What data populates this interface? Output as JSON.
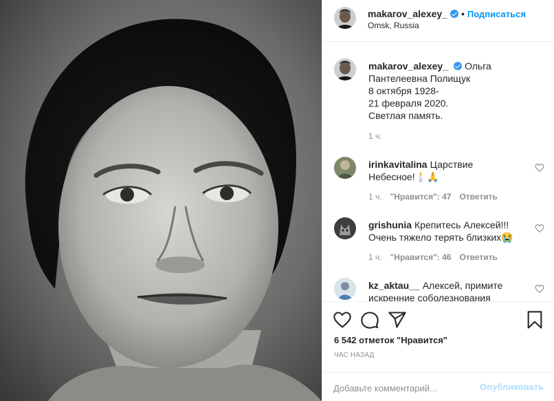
{
  "post": {
    "username": "makarov_alexey_",
    "location": "Omsk, Russia",
    "follow_label": "Подписаться",
    "separator": "•",
    "caption_lines": [
      "Ольга",
      "Пантелеевна Полищук",
      "8 октября 1928-",
      "21 февраля 2020.",
      "Светлая память."
    ],
    "caption_time": "1 ч.",
    "likes_text": "6 542 отметок \"Нравится\"",
    "posted_ago": "час назад",
    "comment_placeholder": "Добавьте комментарий...",
    "publish_label": "Опубликовать"
  },
  "comments": [
    {
      "username": "irinkavitalina",
      "text_line1": "Царствие",
      "text_line2": "Небесное!🕯️🙏",
      "time": "1 ч.",
      "likes": "\"Нравится\": 47",
      "reply": "Ответить"
    },
    {
      "username": "grishunia",
      "text_line1": "Крепитесь Алексей!!!",
      "text_line2": "Очень тяжело терять близких😭",
      "time": "1 ч.",
      "likes": "\"Нравится\": 46",
      "reply": "Ответить"
    },
    {
      "username": "kz_aktau__",
      "text_line1": "Алексей, примите",
      "text_line2": "искренние соболезнования"
    }
  ],
  "icons": {
    "like": "heart-outline-icon",
    "comment": "speech-bubble-icon",
    "share": "paper-plane-icon",
    "save": "bookmark-icon"
  },
  "colors": {
    "accent": "#0095f6",
    "verified": "#3897f0",
    "muted": "#8e8e8e",
    "publish_disabled": "#b2dffc"
  }
}
